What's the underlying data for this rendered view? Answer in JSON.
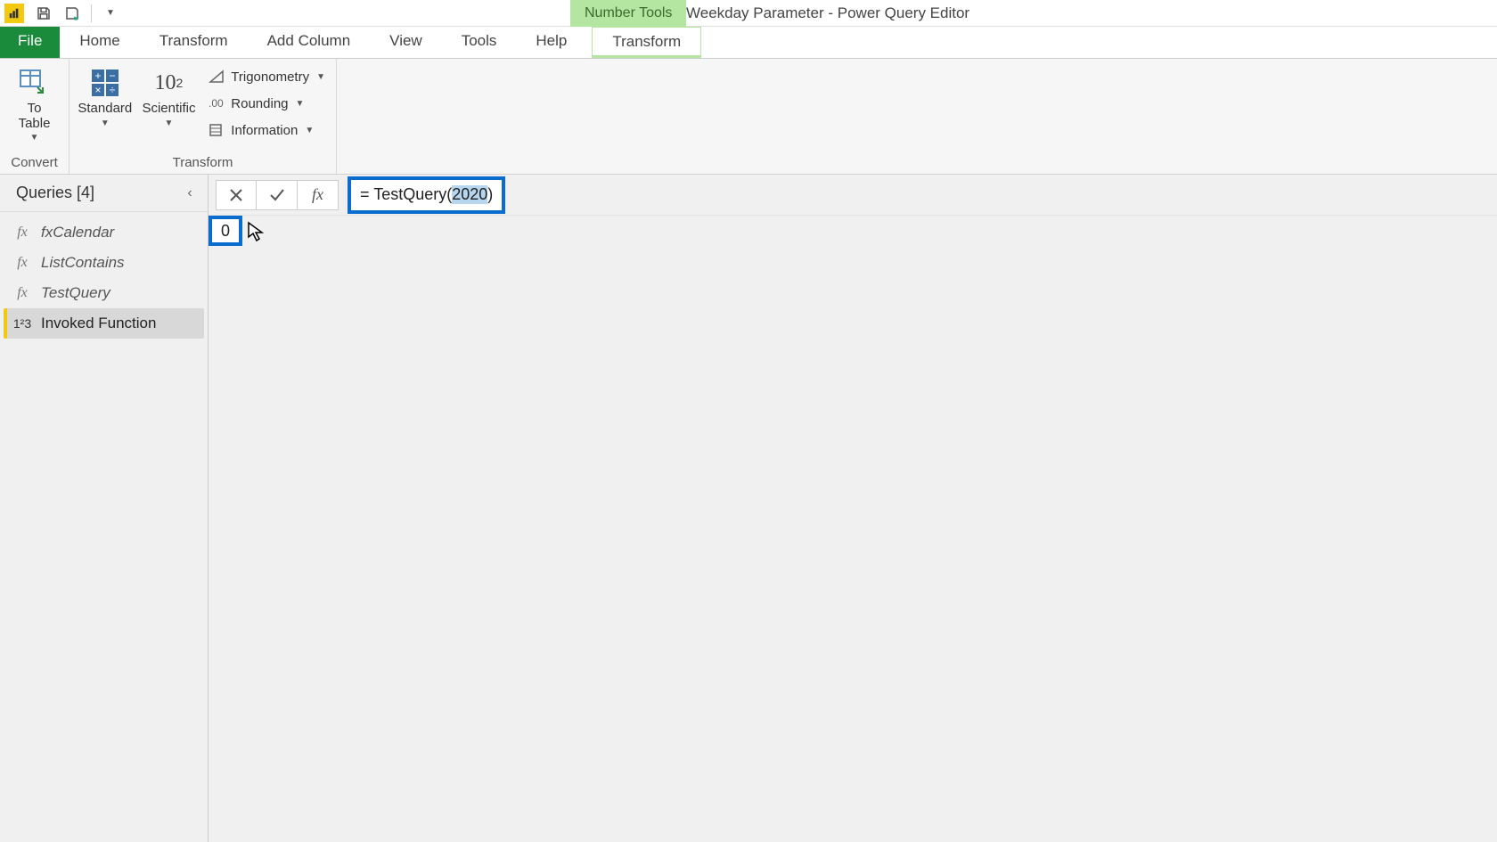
{
  "titlebar": {
    "contextual_tool_label": "Number Tools",
    "window_title": "Weekday Parameter - Power Query Editor"
  },
  "tabs": {
    "file": "File",
    "home": "Home",
    "transform": "Transform",
    "add_column": "Add Column",
    "view": "View",
    "tools": "Tools",
    "help": "Help",
    "contextual_transform": "Transform"
  },
  "ribbon": {
    "convert": {
      "to_table": "To\nTable",
      "group_label": "Convert"
    },
    "transform": {
      "standard": "Standard",
      "scientific": "Scientific",
      "trigonometry": "Trigonometry",
      "rounding": "Rounding",
      "information": "Information",
      "group_label": "Transform"
    }
  },
  "queries": {
    "header": "Queries [4]",
    "items": [
      {
        "icon": "fx",
        "label": "fxCalendar",
        "type": "fn"
      },
      {
        "icon": "fx",
        "label": "ListContains",
        "type": "fn"
      },
      {
        "icon": "fx",
        "label": "TestQuery",
        "type": "fn"
      },
      {
        "icon": "1²3",
        "label": "Invoked Function",
        "type": "num",
        "selected": true
      }
    ]
  },
  "formula": {
    "prefix": "= TestQuery(",
    "selected": "2020",
    "suffix": ")"
  },
  "result": {
    "value": "0"
  }
}
